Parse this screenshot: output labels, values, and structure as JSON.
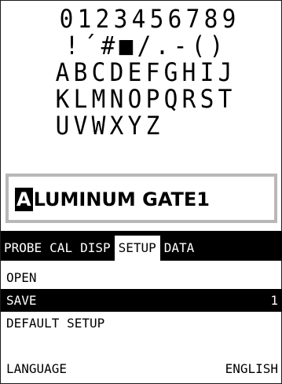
{
  "char_grid": {
    "rows": [
      [
        "0",
        "1",
        "2",
        "3",
        "4",
        "5",
        "6",
        "7",
        "8",
        "9"
      ],
      [
        "!",
        "´",
        "#",
        "■",
        "/",
        ".",
        "-",
        "(",
        ")"
      ],
      [
        "A",
        "B",
        "C",
        "D",
        "E",
        "F",
        "G",
        "H",
        "I",
        "J"
      ],
      [
        "K",
        "L",
        "M",
        "N",
        "O",
        "P",
        "Q",
        "R",
        "S",
        "T"
      ],
      [
        "U",
        "V",
        "W",
        "X",
        "Y",
        "Z"
      ]
    ]
  },
  "name_field": {
    "first_char": "A",
    "rest": "LUMINUM GATE1"
  },
  "tabs": [
    {
      "label": "PROBE",
      "active": false
    },
    {
      "label": "CAL",
      "active": false
    },
    {
      "label": "DISP",
      "active": false
    },
    {
      "label": "SETUP",
      "active": true
    },
    {
      "label": "DATA",
      "active": false
    }
  ],
  "menu": {
    "open": {
      "label": "OPEN",
      "value": ""
    },
    "save": {
      "label": "SAVE",
      "value": "1"
    },
    "default_setup": {
      "label": "DEFAULT SETUP",
      "value": ""
    },
    "language": {
      "label": "LANGUAGE",
      "value": "ENGLISH"
    }
  }
}
